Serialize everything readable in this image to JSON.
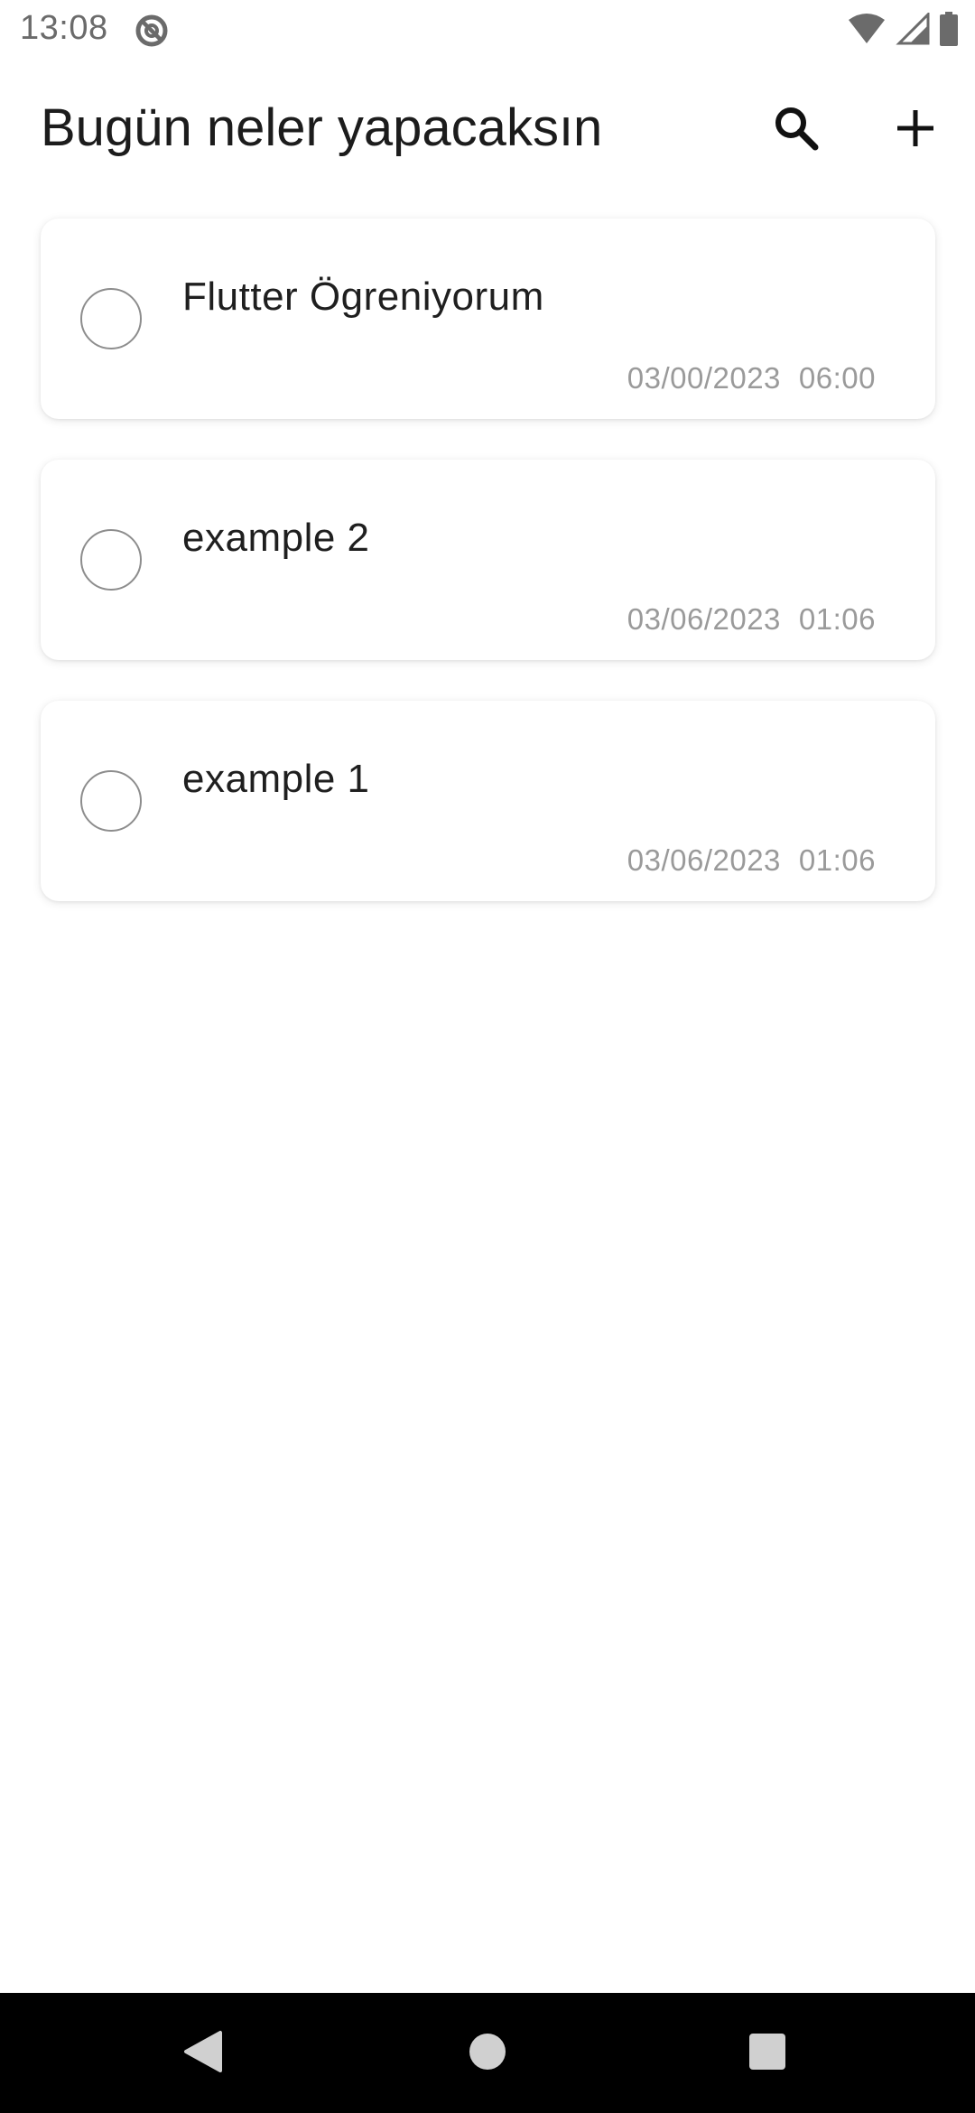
{
  "status_bar": {
    "time": "13:08",
    "icons": [
      "do-not-disturb-icon",
      "wifi-icon",
      "cellular-signal-icon",
      "battery-icon"
    ]
  },
  "app_bar": {
    "title": "Bugün neler yapacaksın",
    "actions": [
      "search-icon",
      "add-icon"
    ]
  },
  "tasks": [
    {
      "title": "Flutter Ögreniyorum",
      "date": "03/00/2023",
      "time": "06:00",
      "completed": false
    },
    {
      "title": "example 2",
      "date": "03/06/2023",
      "time": "01:06",
      "completed": false
    },
    {
      "title": "example 1",
      "date": "03/06/2023",
      "time": "01:06",
      "completed": false
    }
  ],
  "navigation": [
    "back-icon",
    "home-icon",
    "recents-icon"
  ],
  "colors": {
    "background": "#ffffff",
    "text_primary": "#1c1c1c",
    "text_secondary": "#9a9a9a",
    "checkbox_border": "#8d8d8d",
    "nav_bar": "#000000"
  }
}
